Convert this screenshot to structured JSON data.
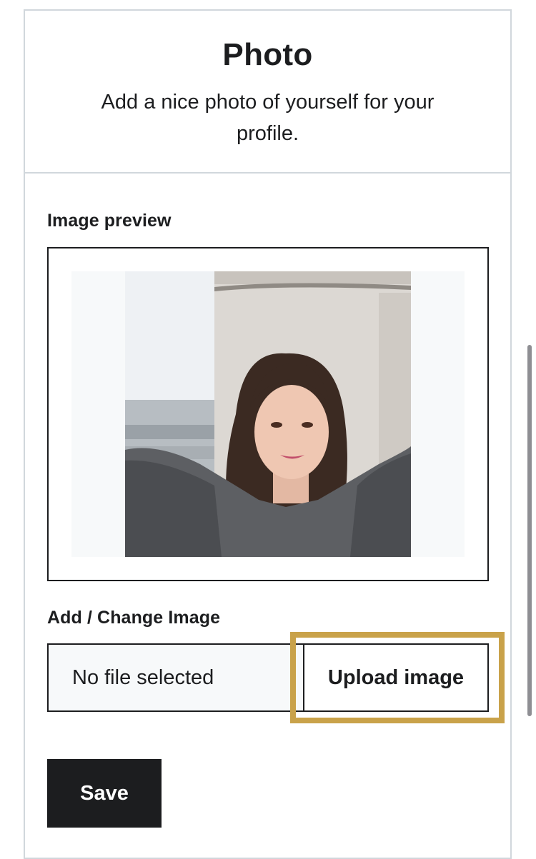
{
  "header": {
    "title": "Photo",
    "subtitle": "Add a nice photo of yourself for your profile."
  },
  "preview": {
    "label": "Image preview",
    "image_alt": "profile-photo"
  },
  "upload": {
    "label": "Add / Change Image",
    "file_status": "No file selected",
    "button_label": "Upload image"
  },
  "actions": {
    "save_label": "Save"
  },
  "colors": {
    "text": "#1c1d1f",
    "border": "#d1d7dc",
    "focus_ring": "#c9a24a",
    "canvas_bg": "#f7f9fa",
    "primary_button": "#1c1d1f"
  }
}
